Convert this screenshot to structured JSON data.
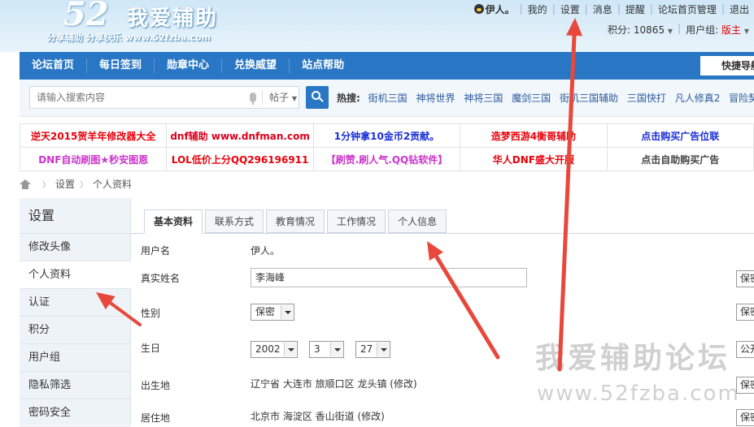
{
  "logo": {
    "number": "52",
    "name": "我爱辅助",
    "slogan": "分享辅助  分享快乐  www.52fzba.com"
  },
  "topbar": {
    "username": "伊人。",
    "links": [
      "我的",
      "设置",
      "消息",
      "提醒",
      "论坛首页管理",
      "退出"
    ]
  },
  "account": {
    "points_label": "积分: 10865",
    "group_label": "用户组:",
    "group_value": "版主"
  },
  "nav": {
    "items": [
      "论坛首页",
      "每日签到",
      "勋章中心",
      "兑换威望",
      "站点帮助"
    ],
    "quick": "快捷导航"
  },
  "search": {
    "placeholder": "请输入搜索内容",
    "scope": "帖子",
    "hot_label": "热搜:",
    "hot": [
      "街机三国",
      "神将世界",
      "神将三国",
      "魔剑三国",
      "街机三国辅助",
      "三国快打",
      "凡人修真2",
      "冒险契约"
    ]
  },
  "ads": {
    "row1": [
      {
        "text": "逆天2015贺羊年修改器大全",
        "color": "#e8000a"
      },
      {
        "text": "dnf辅助 www.dnfman.com",
        "color": "#d9001b"
      },
      {
        "text": "1分钟拿10金币2贡献。",
        "color": "#1a2fd6"
      },
      {
        "text": "造梦西游4衡哥辅助",
        "color": "#e8000a"
      },
      {
        "text": "点击购买广告位联",
        "color": "#1a2fd6"
      }
    ],
    "row2": [
      {
        "text": "DNF自动刷图★秒安图恩",
        "color": "#cc33cc"
      },
      {
        "text": "LOL低价上分QQ296196911",
        "color": "#e8000a"
      },
      {
        "text": "【刷赞.刷人气.QQ钻软件】",
        "color": "#cc33cc"
      },
      {
        "text": "华人DNF盛大开服",
        "color": "#e8000a"
      },
      {
        "text": "点击自助购买广告",
        "color": "#444444"
      }
    ]
  },
  "breadcrumb": {
    "items": [
      "设置",
      "个人资料"
    ]
  },
  "sidebar": {
    "title": "设置",
    "items": [
      "修改头像",
      "个人资料",
      "认证",
      "积分",
      "用户组",
      "隐私筛选",
      "密码安全"
    ]
  },
  "tabs": [
    "基本资料",
    "联系方式",
    "教育情况",
    "工作情况",
    "个人信息"
  ],
  "form": {
    "username": {
      "label": "用户名",
      "value": "伊人。"
    },
    "realname": {
      "label": "真实姓名",
      "value": "李海峰",
      "privacy": "保密"
    },
    "gender": {
      "label": "性别",
      "value": "保密",
      "privacy": "保密"
    },
    "birthday": {
      "label": "生日",
      "year": "2002",
      "month": "3",
      "day": "27",
      "privacy": "公开"
    },
    "birthplace": {
      "label": "出生地",
      "value": "辽宁省 大连市 旅顺口区 龙头镇",
      "edit": "(修改)",
      "privacy": "保密"
    },
    "residence": {
      "label": "居住地",
      "value": "北京市 海淀区 香山街道",
      "edit": "(修改)",
      "privacy": "保密"
    }
  },
  "watermark": {
    "line1": "我爱辅助论坛",
    "line2": "www.52fzba.com"
  },
  "colors": {
    "nav": "#2876c4",
    "annotation_arrow": "#e8483c"
  }
}
